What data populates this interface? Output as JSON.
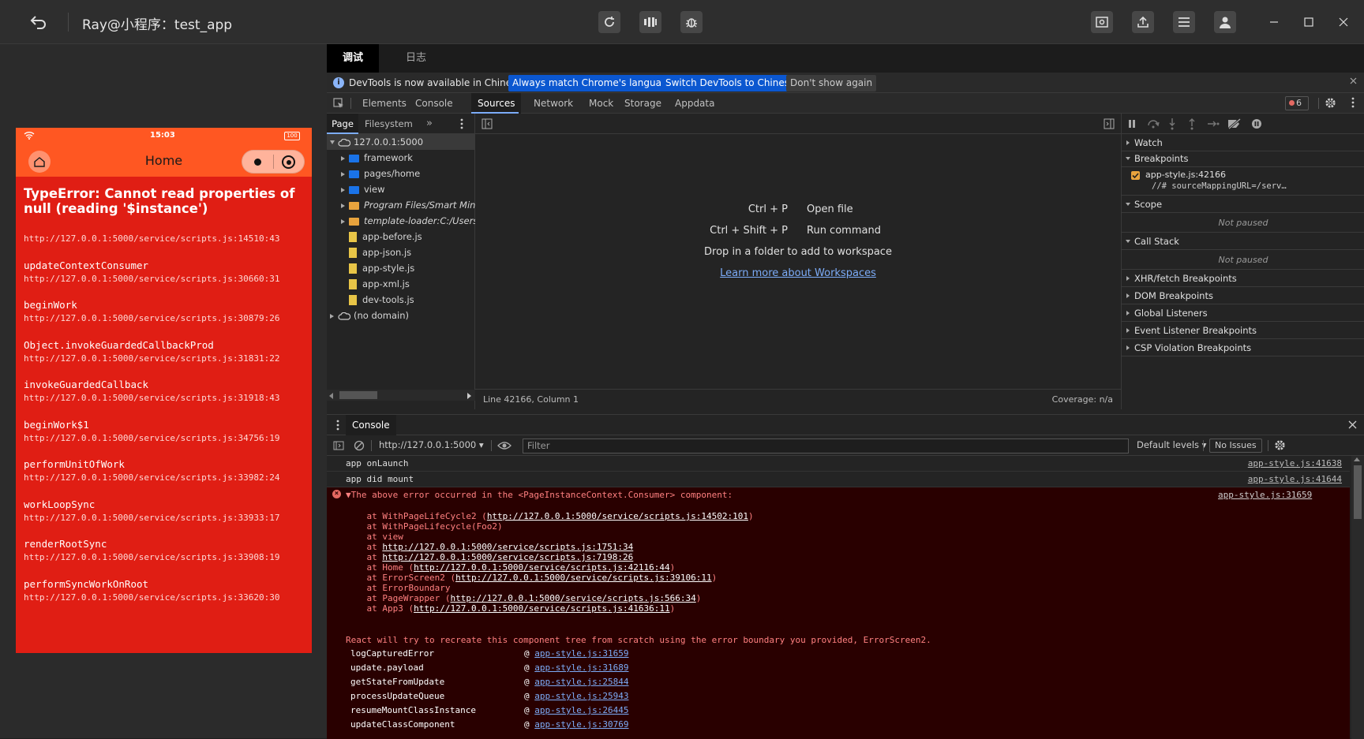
{
  "titlebar": {
    "title": "Ray@小程序：test_app",
    "tools": [
      "refresh-icon",
      "compile-icon",
      "debug-icon"
    ],
    "right_tools": [
      "preview-icon",
      "upload-icon",
      "details-icon",
      "account-icon"
    ]
  },
  "phone": {
    "status_time": "15:03",
    "battery": "100",
    "nav_title": "Home",
    "error_title": "TypeError: Cannot read properties of null (reading '$instance')",
    "stack": [
      {
        "fn": "",
        "url": "http://127.0.0.1:5000/service/scripts.js:14510:43"
      },
      {
        "fn": "updateContextConsumer",
        "url": "http://127.0.0.1:5000/service/scripts.js:30660:31"
      },
      {
        "fn": "beginWork",
        "url": "http://127.0.0.1:5000/service/scripts.js:30879:26"
      },
      {
        "fn": "Object.invokeGuardedCallbackProd",
        "url": "http://127.0.0.1:5000/service/scripts.js:31831:22"
      },
      {
        "fn": "invokeGuardedCallback",
        "url": "http://127.0.0.1:5000/service/scripts.js:31918:43"
      },
      {
        "fn": "beginWork$1",
        "url": "http://127.0.0.1:5000/service/scripts.js:34756:19"
      },
      {
        "fn": "performUnitOfWork",
        "url": "http://127.0.0.1:5000/service/scripts.js:33982:24"
      },
      {
        "fn": "workLoopSync",
        "url": "http://127.0.0.1:5000/service/scripts.js:33933:17"
      },
      {
        "fn": "renderRootSync",
        "url": "http://127.0.0.1:5000/service/scripts.js:33908:19"
      },
      {
        "fn": "performSyncWorkOnRoot",
        "url": "http://127.0.0.1:5000/service/scripts.js:33620:30"
      }
    ]
  },
  "devtools": {
    "top_tabs": [
      "调试",
      "日志"
    ],
    "infobar": {
      "text": "DevTools is now available in Chinese!",
      "btn_match": "Always match Chrome's language",
      "btn_switch": "Switch DevTools to Chinese",
      "btn_dont": "Don't show again"
    },
    "panel_tabs": [
      "Elements",
      "Console",
      "Sources",
      "Network",
      "Mock",
      "Storage",
      "Appdata"
    ],
    "active_panel": "Sources",
    "error_count": "6",
    "nav_tabs": [
      "Page",
      "Filesystem"
    ],
    "tree": [
      {
        "label": "127.0.0.1:5000",
        "kind": "cloud",
        "indent": 0,
        "arrow": "open"
      },
      {
        "label": "framework",
        "kind": "folder",
        "indent": 1,
        "arrow": "closed"
      },
      {
        "label": "pages/home",
        "kind": "folder",
        "indent": 1,
        "arrow": "closed"
      },
      {
        "label": "view",
        "kind": "folder",
        "indent": 1,
        "arrow": "closed"
      },
      {
        "label": "Program Files/Smart MiniA",
        "kind": "folder-orange",
        "indent": 1,
        "arrow": "closed",
        "italic": true
      },
      {
        "label": "template-loader:C:/Users/A",
        "kind": "folder-orange",
        "indent": 1,
        "arrow": "closed",
        "italic": true
      },
      {
        "label": "app-before.js",
        "kind": "file",
        "indent": 1
      },
      {
        "label": "app-json.js",
        "kind": "file",
        "indent": 1
      },
      {
        "label": "app-style.js",
        "kind": "file",
        "indent": 1
      },
      {
        "label": "app-xml.js",
        "kind": "file",
        "indent": 1
      },
      {
        "label": "dev-tools.js",
        "kind": "file",
        "indent": 1
      },
      {
        "label": "(no domain)",
        "kind": "cloud",
        "indent": 0,
        "arrow": "closed"
      }
    ],
    "editor": {
      "shortcut1_key": "Ctrl + P",
      "shortcut1_label": "Open file",
      "shortcut2_key": "Ctrl + Shift + P",
      "shortcut2_label": "Run command",
      "drop_text": "Drop in a folder to add to workspace",
      "learn_link": "Learn more about Workspaces",
      "status_left": "Line 42166, Column 1",
      "status_right": "Coverage: n/a"
    },
    "debugger": {
      "watch": "Watch",
      "breakpoints": "Breakpoints",
      "bp_file": "app-style.js:42166",
      "bp_code": "//# sourceMappingURL=/serv…",
      "scope": "Scope",
      "not_paused": "Not paused",
      "call_stack": "Call Stack",
      "not_paused2": "Not paused",
      "xhr": "XHR/fetch Breakpoints",
      "dom": "DOM Breakpoints",
      "global": "Global Listeners",
      "event": "Event Listener Breakpoints",
      "csp": "CSP Violation Breakpoints"
    },
    "console": {
      "tab": "Console",
      "context": "http://127.0.0.1:5000",
      "filter_placeholder": "Filter",
      "levels": "Default levels",
      "issues": "No Issues",
      "log1": "app onLaunch",
      "log1_src": "app-style.js:41638",
      "log2": "app did mount",
      "log2_src": "app-style.js:41644",
      "err_head": "▼The above error occurred in the <PageInstanceContext.Consumer> component:",
      "err_src": "app-style.js:31659",
      "err_lines": [
        {
          "pre": "    at WithPageLifeCycle2 (",
          "link": "http://127.0.0.1:5000/service/scripts.js:14502:101",
          "post": ")"
        },
        {
          "pre": "    at WithPageLifecycle(Foo2)",
          "link": "",
          "post": ""
        },
        {
          "pre": "    at view",
          "link": "",
          "post": ""
        },
        {
          "pre": "    at ",
          "link": "http://127.0.0.1:5000/service/scripts.js:1751:34",
          "post": ""
        },
        {
          "pre": "    at ",
          "link": "http://127.0.0.1:5000/service/scripts.js:7198:26",
          "post": ""
        },
        {
          "pre": "    at Home (",
          "link": "http://127.0.0.1:5000/service/scripts.js:42116:44",
          "post": ")"
        },
        {
          "pre": "    at ErrorScreen2 (",
          "link": "http://127.0.0.1:5000/service/scripts.js:39106:11",
          "post": ")"
        },
        {
          "pre": "    at ErrorBoundary",
          "link": "",
          "post": ""
        },
        {
          "pre": "    at PageWrapper (",
          "link": "http://127.0.0.1:5000/service/scripts.js:566:34",
          "post": ")"
        },
        {
          "pre": "    at App3 (",
          "link": "http://127.0.0.1:5000/service/scripts.js:41636:11",
          "post": ")"
        }
      ],
      "react_msg": "React will try to recreate this component tree from scratch using the error boundary you provided, ErrorScreen2.",
      "trace": [
        {
          "fn": "logCapturedError",
          "src": "app-style.js:31659"
        },
        {
          "fn": "update.payload",
          "src": "app-style.js:31689"
        },
        {
          "fn": "getStateFromUpdate",
          "src": "app-style.js:25844"
        },
        {
          "fn": "processUpdateQueue",
          "src": "app-style.js:25943"
        },
        {
          "fn": "resumeMountClassInstance",
          "src": "app-style.js:26445"
        },
        {
          "fn": "updateClassComponent",
          "src": "app-style.js:30769"
        }
      ]
    }
  }
}
